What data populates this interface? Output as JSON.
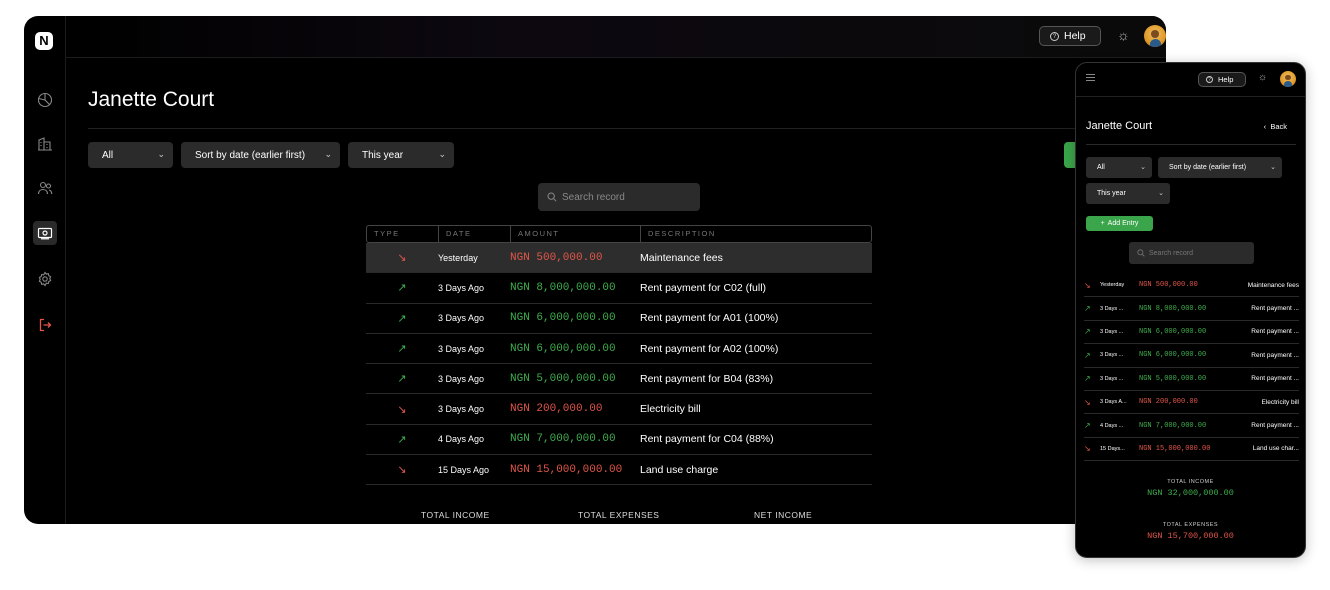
{
  "app": {
    "logo": "N",
    "help_label": "Help",
    "help_glyph": "?"
  },
  "page": {
    "title": "Janette Court"
  },
  "filters": {
    "type_value": "All",
    "sort_value": "Sort by date (earlier first)",
    "period_value": "This year"
  },
  "search": {
    "placeholder": "Search record"
  },
  "table": {
    "headers": [
      "TYPE",
      "DATE",
      "AMOUNT",
      "DESCRIPTION"
    ],
    "rows": [
      {
        "type": "expense",
        "date": "Yesterday",
        "amount": "NGN 500,000.00",
        "description": "Maintenance fees"
      },
      {
        "type": "income",
        "date": "3 Days Ago",
        "amount": "NGN 8,000,000.00",
        "description": "Rent payment for C02 (full)"
      },
      {
        "type": "income",
        "date": "3 Days Ago",
        "amount": "NGN 6,000,000.00",
        "description": "Rent payment for A01 (100%)"
      },
      {
        "type": "income",
        "date": "3 Days Ago",
        "amount": "NGN 6,000,000.00",
        "description": "Rent payment for A02 (100%)"
      },
      {
        "type": "income",
        "date": "3 Days Ago",
        "amount": "NGN 5,000,000.00",
        "description": "Rent payment for B04 (83%)"
      },
      {
        "type": "expense",
        "date": "3 Days Ago",
        "amount": "NGN 200,000.00",
        "description": "Electricity bill"
      },
      {
        "type": "income",
        "date": "4 Days Ago",
        "amount": "NGN 7,000,000.00",
        "description": "Rent payment for C04 (88%)"
      },
      {
        "type": "expense",
        "date": "15 Days Ago",
        "amount": "NGN 15,000,000.00",
        "description": "Land use charge"
      }
    ]
  },
  "totals": {
    "income_label": "TOTAL INCOME",
    "expenses_label": "TOTAL EXPENSES",
    "net_label": "NET INCOME",
    "income_value": "NGN 32,000,000.00",
    "expenses_value": "NGN 15,700,000.00"
  },
  "mobile": {
    "back_label": "Back",
    "add_entry_label": "Add Entry",
    "rows": [
      {
        "type": "expense",
        "date": "Yesterday",
        "amount": "NGN 500,000.00",
        "description": "Maintenance fees"
      },
      {
        "type": "income",
        "date": "3 Days ...",
        "amount": "NGN 8,000,000.00",
        "description": "Rent payment ..."
      },
      {
        "type": "income",
        "date": "3 Days ...",
        "amount": "NGN 6,000,000.00",
        "description": "Rent payment ..."
      },
      {
        "type": "income",
        "date": "3 Days ...",
        "amount": "NGN 6,000,000.00",
        "description": "Rent payment ..."
      },
      {
        "type": "income",
        "date": "3 Days ...",
        "amount": "NGN 5,000,000.00",
        "description": "Rent payment ..."
      },
      {
        "type": "expense",
        "date": "3 Days A...",
        "amount": "NGN 200,000.00",
        "description": "Electricity bill"
      },
      {
        "type": "income",
        "date": "4 Days ...",
        "amount": "NGN 7,000,000.00",
        "description": "Rent payment ..."
      },
      {
        "type": "expense",
        "date": "15 Days...",
        "amount": "NGN 15,000,000.00",
        "description": "Land use char..."
      }
    ]
  },
  "icons": {
    "sidebar": [
      "pie-chart-icon",
      "building-icon",
      "users-icon",
      "money-icon",
      "settings-icon",
      "logout-icon"
    ],
    "income_arrow": "↗",
    "expense_arrow": "↘",
    "sun_glyph": "☼",
    "chevron_glyph": "⌄"
  },
  "colors": {
    "income": "#3fae4c",
    "expense": "#e0564a",
    "accent": "#3aa54a",
    "logout": "#e0564a"
  }
}
